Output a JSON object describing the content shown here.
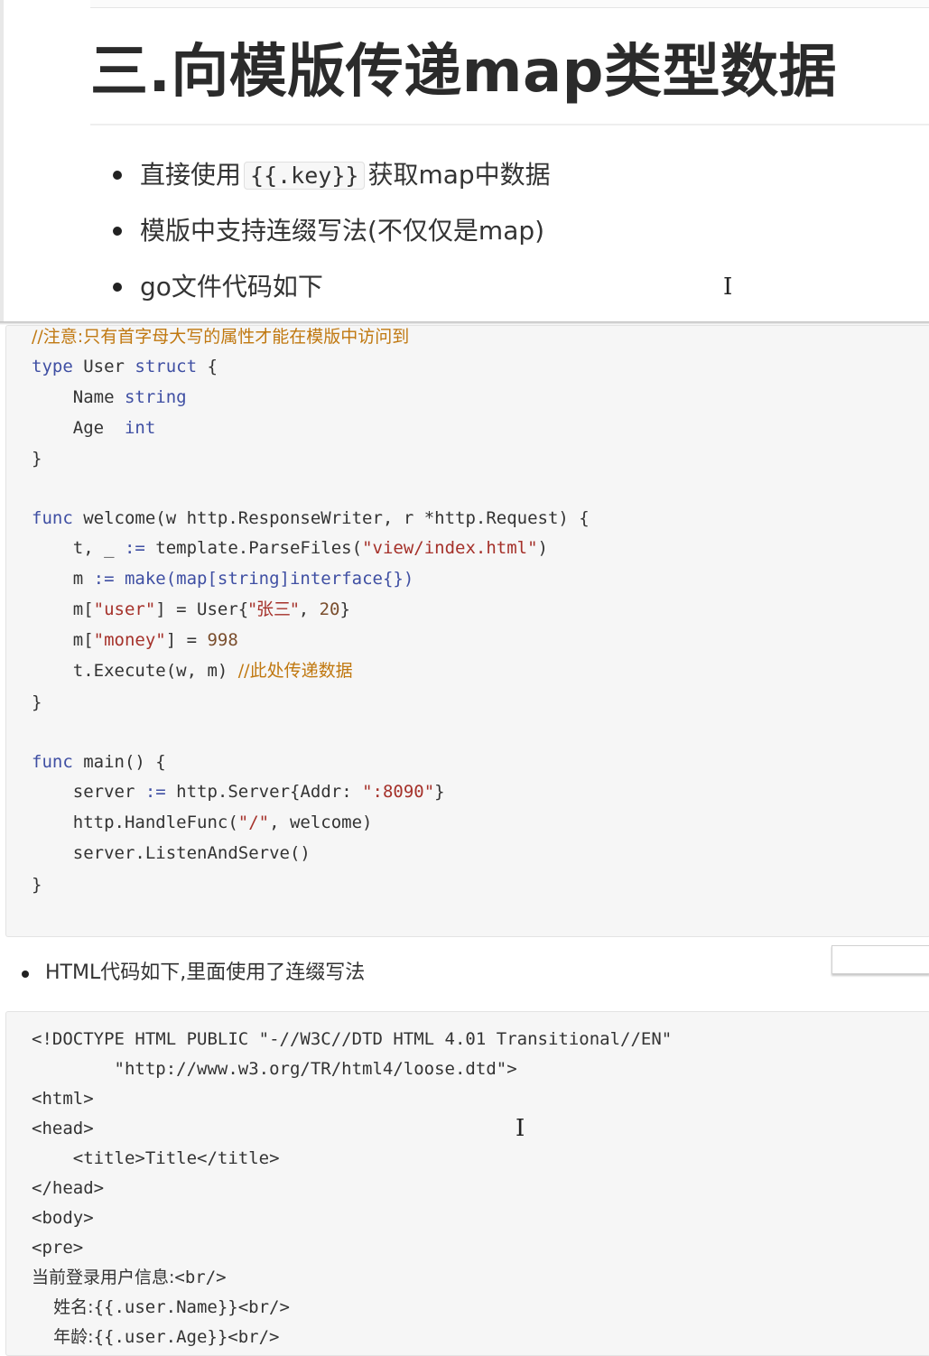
{
  "title": "三.向模版传递map类型数据",
  "bullets": {
    "b1_pre": "直接使用",
    "b1_code": "{{.key}}",
    "b1_post": "获取map中数据",
    "b2": "模版中支持连缀写法(不仅仅是map)",
    "b3": "go文件代码如下"
  },
  "go_code": {
    "comment": "//注意:只有首字母大写的属性才能在模版中访问到",
    "l_type": "type",
    "l_user": " User ",
    "l_struct": "struct",
    "l_brace": " {",
    "l_name": "    Name ",
    "l_string": "string",
    "l_age": "    Age  ",
    "l_int": "int",
    "l_close": "}",
    "w_func": "func",
    "w_sig": " welcome(w http.ResponseWriter, r *http.Request) {",
    "w_t": "    t, _ ",
    "w_assign": ":=",
    "w_parse": " template.ParseFiles(",
    "w_path": "\"view/index.html\"",
    "w_paren": ")",
    "w_m": "    m ",
    "w_make": " make(map[string]interface{})",
    "w_m_user": "    m[",
    "w_user_key": "\"user\"",
    "w_eq": "] = User{",
    "w_zhangsan": "\"张三\"",
    "w_comma": ", ",
    "w_20": "20",
    "w_endbrace": "}",
    "w_m_money": "    m[",
    "w_money_key": "\"money\"",
    "w_eq2": "] = ",
    "w_998": "998",
    "w_exec": "    t.Execute(w, m) ",
    "w_exec_cmt": "//此处传递数据",
    "m_func": "func",
    "m_sig": " main() {",
    "m_server": "    server ",
    "m_assign": ":=",
    "m_struct": " http.Server{Addr: ",
    "m_addr": "\":8090\"",
    "m_end": "}",
    "m_handle": "    http.HandleFunc(",
    "m_slash": "\"/\"",
    "m_handle_end": ", welcome)",
    "m_listen": "    server.ListenAndServe()"
  },
  "html_bullet": "HTML代码如下,里面使用了连缀写法",
  "html_code": {
    "l1": "<!DOCTYPE HTML PUBLIC \"-//W3C//DTD HTML 4.01 Transitional//EN\"",
    "l2": "        \"http://www.w3.org/TR/html4/loose.dtd\">",
    "l3": "<html>",
    "l4": "<head>",
    "l5": "    <title>Title</title>",
    "l6": "</head>",
    "l7": "<body>",
    "l8": "<pre>",
    "l9a": "当前登录用户信息:",
    "l9b": "<br/>",
    "l10a": "    姓名:",
    "l10b": "{{.user.Name}}<br/>",
    "l11a": "    年龄:",
    "l11b": "{{.user.Age}}<br/>"
  }
}
